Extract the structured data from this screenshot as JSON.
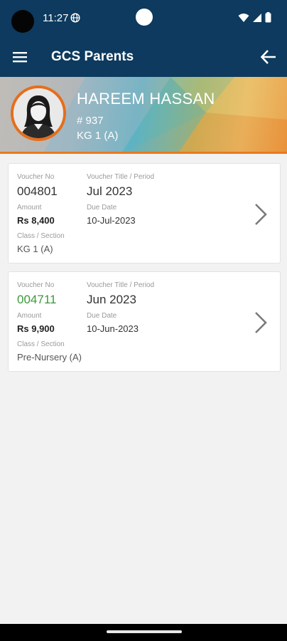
{
  "status_bar": {
    "time": "11:27"
  },
  "app_bar": {
    "title": "GCS Parents"
  },
  "student": {
    "name": "HAREEM HASSAN",
    "id": "# 937",
    "class": "KG 1 (A)"
  },
  "labels": {
    "voucher_no": "Voucher No",
    "voucher_title": "Voucher Title / Period",
    "amount": "Amount",
    "due_date": "Due Date",
    "class_section": "Class / Section"
  },
  "vouchers": [
    {
      "voucher_no": "004801",
      "title": "Jul 2023",
      "amount": "Rs 8,400",
      "due_date": "10-Jul-2023",
      "class_section": "KG 1 (A)",
      "voucher_no_color": "#333333"
    },
    {
      "voucher_no": "004711",
      "title": "Jun 2023",
      "amount": "Rs 9,900",
      "due_date": "10-Jun-2023",
      "class_section": "Pre-Nursery (A)",
      "voucher_no_color": "#3a9a3a"
    }
  ],
  "colors": {
    "primary": "#0d3a5e",
    "accent": "#e66e1b",
    "paid_green": "#3a9a3a"
  },
  "icons": [
    "menu-icon",
    "back-arrow-icon",
    "chevron-right-icon",
    "wifi-icon",
    "signal-icon",
    "battery-icon",
    "globe-icon"
  ]
}
